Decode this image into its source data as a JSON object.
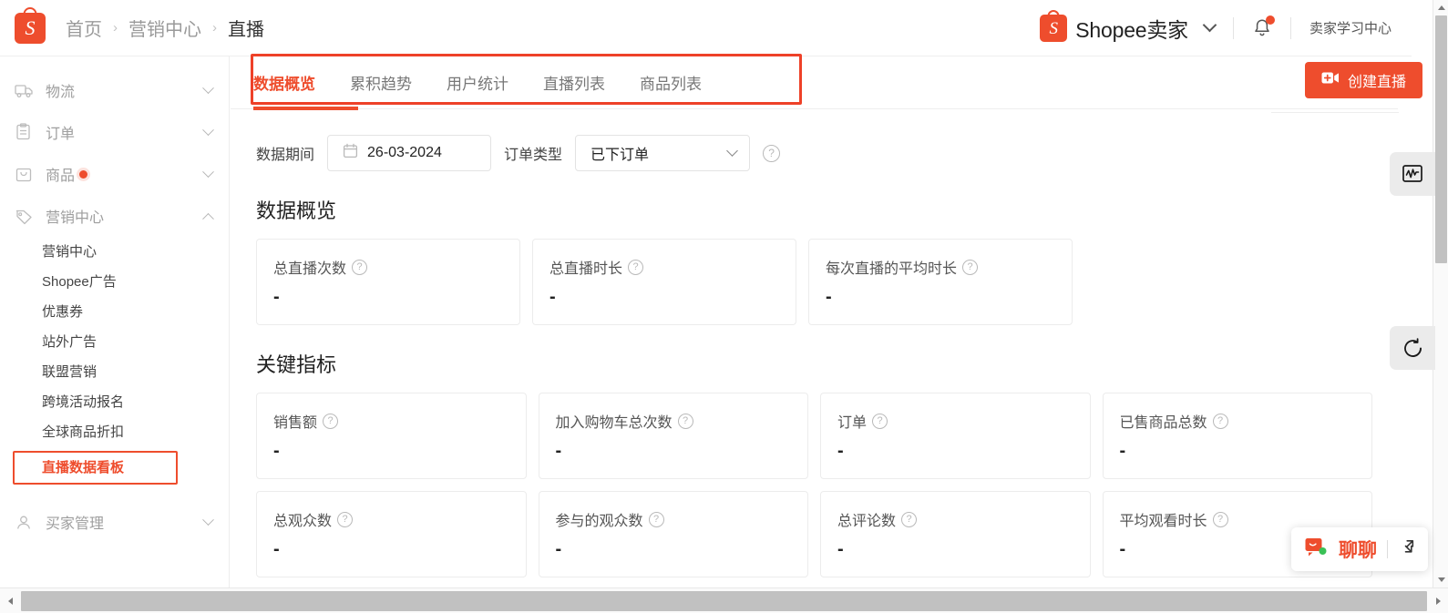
{
  "header": {
    "logo_icon": "shopee-bag-icon",
    "breadcrumb": [
      {
        "label": "首页",
        "active": false
      },
      {
        "label": "营销中心",
        "active": false
      },
      {
        "label": "直播",
        "active": true
      }
    ],
    "separator": "›",
    "seller_brand": "Shopee卖家",
    "dropdown_icon": "chevron-down-icon",
    "notification_icon": "bell-icon",
    "notification_badge": true,
    "learning_center": "卖家学习中心"
  },
  "sidebar": {
    "groups": [
      {
        "label": "物流",
        "icon": "truck-icon",
        "expanded": false,
        "badge": false
      },
      {
        "label": "订单",
        "icon": "clipboard-icon",
        "expanded": false,
        "badge": false
      },
      {
        "label": "商品",
        "icon": "bag-icon",
        "expanded": false,
        "badge": true
      },
      {
        "label": "营销中心",
        "icon": "tag-icon",
        "expanded": true,
        "badge": false
      }
    ],
    "marketing_items": [
      {
        "label": "营销中心",
        "highlighted": false
      },
      {
        "label": "Shopee广告",
        "highlighted": false
      },
      {
        "label": "优惠券",
        "highlighted": false
      },
      {
        "label": "站外广告",
        "highlighted": false
      },
      {
        "label": "联盟营销",
        "highlighted": false
      },
      {
        "label": "跨境活动报名",
        "highlighted": false
      },
      {
        "label": "全球商品折扣",
        "highlighted": false
      },
      {
        "label": "直播数据看板",
        "highlighted": true
      }
    ],
    "bottom_group": {
      "label": "买家管理",
      "icon": "user-icon",
      "expanded": false
    }
  },
  "tabs": [
    {
      "label": "数据概览",
      "active": true
    },
    {
      "label": "累积趋势",
      "active": false
    },
    {
      "label": "用户统计",
      "active": false
    },
    {
      "label": "直播列表",
      "active": false
    },
    {
      "label": "商品列表",
      "active": false
    }
  ],
  "create_button": {
    "label": "创建直播",
    "icon": "video-plus-icon"
  },
  "filters": {
    "date_label": "数据期间",
    "date_value": "26-03-2024",
    "date_icon": "calendar-icon",
    "order_type_label": "订单类型",
    "order_type_value": "已下订单",
    "order_type_options": [
      "已下订单"
    ],
    "help_icon": "question-circle-icon"
  },
  "overview": {
    "title": "数据概览",
    "cards": [
      {
        "label": "总直播次数",
        "value": "-",
        "help": "question-circle-icon"
      },
      {
        "label": "总直播时长",
        "value": "-",
        "help": "question-circle-icon"
      },
      {
        "label": "每次直播的平均时长",
        "value": "-",
        "help": "question-circle-icon"
      }
    ]
  },
  "key_metrics": {
    "title": "关键指标",
    "row1": [
      {
        "label": "销售额",
        "value": "-",
        "help": "question-circle-icon"
      },
      {
        "label": "加入购物车总次数",
        "value": "-",
        "help": "question-circle-icon"
      },
      {
        "label": "订单",
        "value": "-",
        "help": "question-circle-icon"
      },
      {
        "label": "已售商品总数",
        "value": "-",
        "help": "question-circle-icon"
      }
    ],
    "row2": [
      {
        "label": "总观众数",
        "value": "-",
        "help": "question-circle-icon"
      },
      {
        "label": "参与的观众数",
        "value": "-",
        "help": "question-circle-icon"
      },
      {
        "label": "总评论数",
        "value": "-",
        "help": "question-circle-icon"
      },
      {
        "label": "平均观看时长",
        "value": "-",
        "help": "question-circle-icon"
      }
    ]
  },
  "float_widgets": [
    {
      "name": "monitor-icon"
    },
    {
      "name": "refresh-circle-icon"
    }
  ],
  "chat_widget": {
    "label": "聊聊",
    "icon": "chat-bubble-icon",
    "expand_icon": "expand-arrow-icon"
  },
  "colors": {
    "accent": "#ee4d2d",
    "annotation": "#ee4128",
    "text": "#222222",
    "muted": "#9e9e9e"
  }
}
